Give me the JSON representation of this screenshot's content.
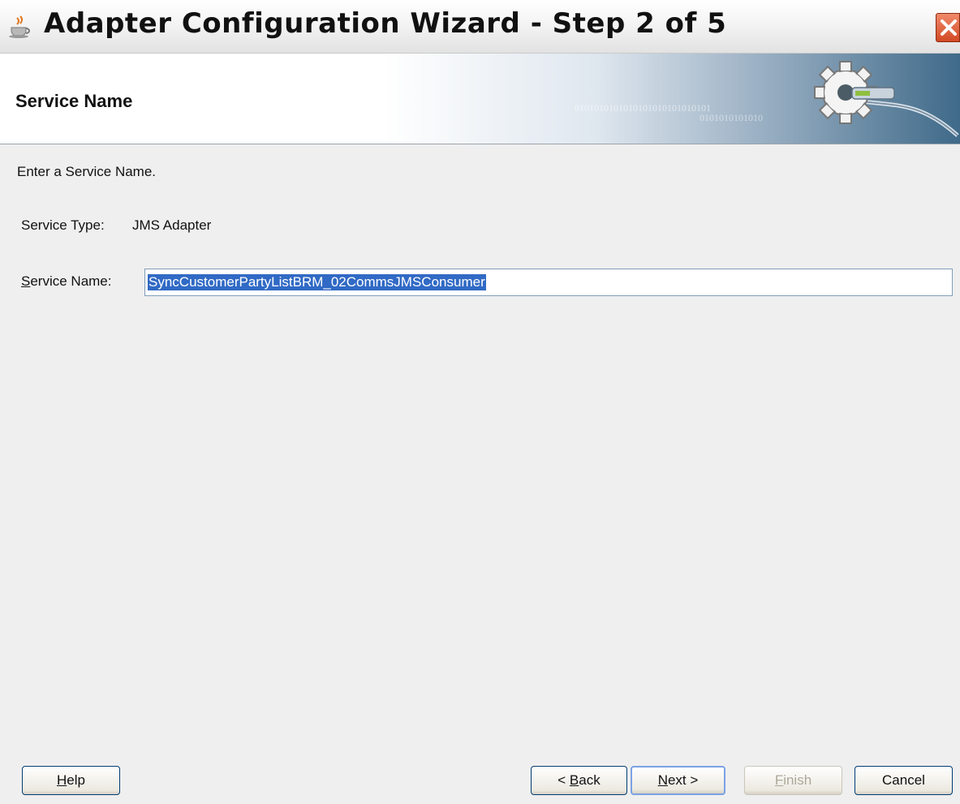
{
  "window": {
    "title": "Adapter Configuration Wizard - Step 2 of 5"
  },
  "banner": {
    "title": "Service Name",
    "binary_line1": "0101010101010101010101010101",
    "binary_line2": "0101010101010"
  },
  "content": {
    "instruction": "Enter a Service Name.",
    "service_type_label": "Service Type:",
    "service_type_value": "JMS Adapter",
    "service_name_label_mnemonic": "S",
    "service_name_label_rest": "ervice Name:",
    "service_name_value": "SyncCustomerPartyListBRM_02CommsJMSConsumer"
  },
  "buttons": {
    "help_mnemonic": "H",
    "help_rest": "elp",
    "back_prefix": "< ",
    "back_mnemonic": "B",
    "back_rest": "ack",
    "next_mnemonic": "N",
    "next_rest": "ext >",
    "finish_mnemonic": "F",
    "finish_rest": "inish",
    "cancel_label": "Cancel",
    "finish_enabled": false
  },
  "icons": {
    "app": "java-cup-icon",
    "close": "close-icon",
    "banner": "gear-connector-icon"
  }
}
